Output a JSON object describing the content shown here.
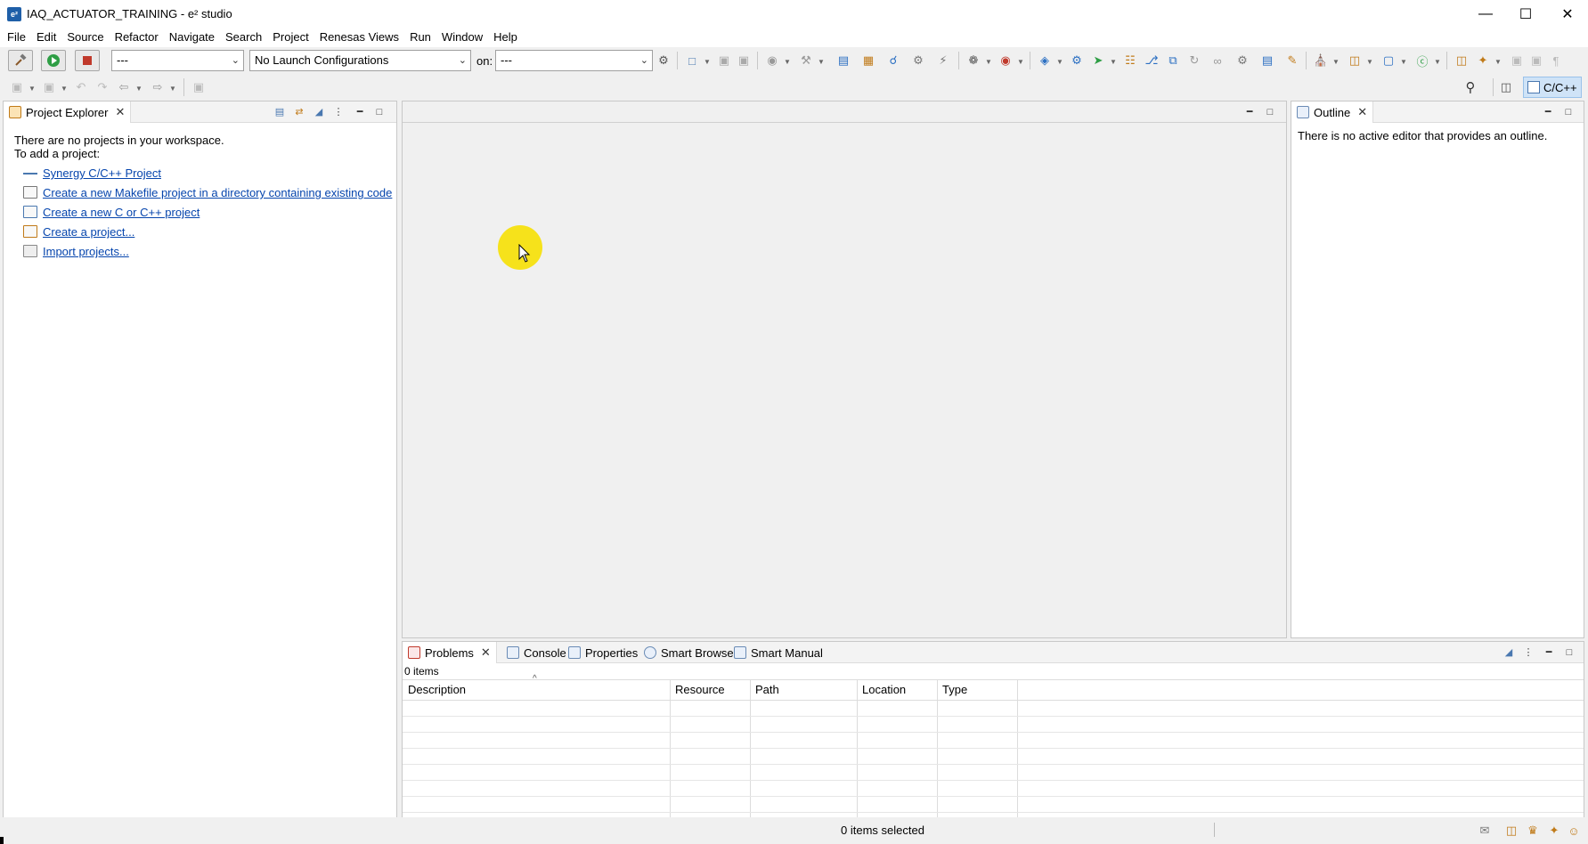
{
  "window": {
    "title": "IAQ_ACTUATOR_TRAINING - e² studio",
    "app_icon": "e2-studio-icon",
    "controls": {
      "minimize": "—",
      "maximize": "☐",
      "close": "✕"
    }
  },
  "menu": [
    "File",
    "Edit",
    "Source",
    "Refactor",
    "Navigate",
    "Search",
    "Project",
    "Renesas Views",
    "Run",
    "Window",
    "Help"
  ],
  "toolbar": {
    "build_config": "---",
    "launch_config": "No Launch Configurations",
    "on_label": "on:",
    "target": "---",
    "perspective": "C/C++"
  },
  "project_explorer": {
    "tab_label": "Project Explorer",
    "message_line1": "There are no projects in your workspace.",
    "message_line2": "To add a project:",
    "links": [
      "Synergy C/C++ Project",
      "Create a new Makefile project in a directory containing existing code",
      "Create a new C or C++ project",
      "Create a project...",
      "Import projects..."
    ]
  },
  "outline": {
    "tab_label": "Outline",
    "message": "There is no active editor that provides an outline."
  },
  "bottom_panel": {
    "tabs": [
      "Problems",
      "Console",
      "Properties",
      "Smart Browser",
      "Smart Manual"
    ],
    "items_count": "0 items",
    "sort_indicator": "^",
    "columns": [
      "Description",
      "Resource",
      "Path",
      "Location",
      "Type"
    ]
  },
  "status": {
    "selection": "0 items selected"
  },
  "colors": {
    "link": "#0645ad",
    "cursor_highlight": "#f5e00f",
    "perspective_active": "#cfe3f7"
  }
}
